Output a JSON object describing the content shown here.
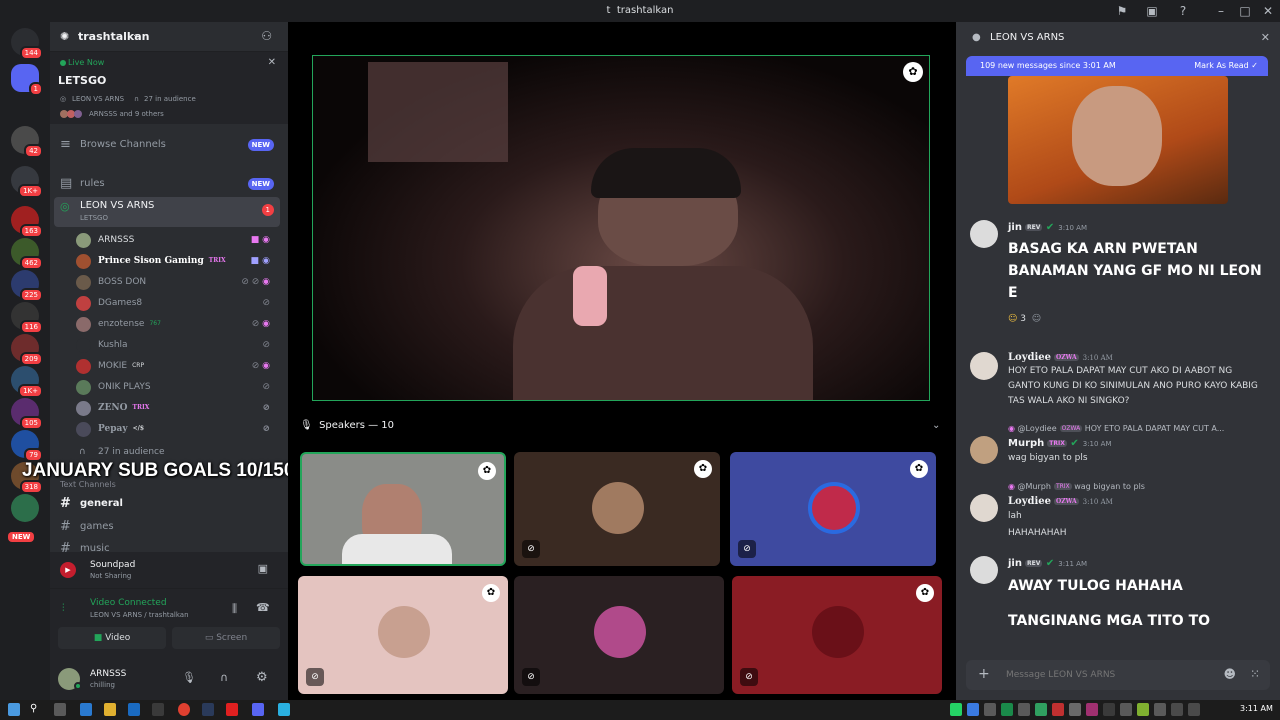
{
  "window": {
    "title": "trashtalkan",
    "title_glyph": "t"
  },
  "servers": {
    "badges": [
      "144",
      "1",
      "42",
      "1K+",
      "163",
      "462",
      "225",
      "116",
      "209",
      "1K+",
      "105",
      "79",
      "318"
    ],
    "new_label": "NEW"
  },
  "channel_sidebar": {
    "server_name": "trashtalkan",
    "live": {
      "status": "Live Now",
      "event": "LETSGO",
      "stage": "LEON VS ARNS",
      "audience": "27 in audience",
      "participants": "ARNSSS and 9 others"
    },
    "browse": "Browse Channels",
    "new_badge": "NEW",
    "rules": "rules",
    "stage_channel": {
      "name": "LEON VS ARNS",
      "topic": "LETSGO",
      "badge": "1"
    },
    "voice_users": [
      {
        "name": "ARNSSS",
        "tag": ""
      },
      {
        "name": "Prince Sison Gaming",
        "tag": "TRIX"
      },
      {
        "name": "BOSS DON",
        "tag": ""
      },
      {
        "name": "DGames8",
        "tag": ""
      },
      {
        "name": "enzotense",
        "tag": "767"
      },
      {
        "name": "Kushla",
        "tag": ""
      },
      {
        "name": "MOKIE",
        "tag": "CRP"
      },
      {
        "name": "ONIK PLAYS",
        "tag": ""
      },
      {
        "name": "ZENO",
        "tag": "TRIX"
      },
      {
        "name": "Pepay",
        "tag": "</$"
      }
    ],
    "audience": "27 in audience",
    "text_channels_header": "Text Channels",
    "text_channels": [
      "general",
      "games",
      "music"
    ],
    "soundpad": {
      "name": "Soundpad",
      "status": "Not Sharing"
    },
    "voice_connected": {
      "status": "Video Connected",
      "location": "LEON VS ARNS / trashtalkan"
    },
    "video_btn": "Video",
    "screen_btn": "Screen",
    "user": {
      "name": "ARNSSS",
      "status": "chilling"
    }
  },
  "overlay_text": "JANUARY SUB GOALS 10/150",
  "stage": {
    "speakers_label": "Speakers — 10"
  },
  "chat": {
    "title": "LEON VS ARNS",
    "new_messages": "109 new messages since 3:01 AM",
    "mark_read": "Mark As Read",
    "messages": [
      {
        "user": "jin",
        "tag": "REV",
        "time": "3:10 AM",
        "text": "BASAG KA ARN PWETAN BANAMAN YANG GF MO NI LEON E",
        "reaction": "3"
      },
      {
        "user": "Loydiee",
        "tag": "OZWA",
        "time": "3:10 AM",
        "text": "HOY ETO PALA DAPAT MAY CUT AKO DI AABOT NG GANTO KUNG DI KO SINIMULAN ANO PURO KAYO KABIG TAS WALA AKO NI SINGKO?"
      },
      {
        "reply_user": "@Loydiee",
        "reply_tag": "OZWA",
        "reply_text": "HOY ETO PALA DAPAT MAY CUT A...",
        "user": "Murph",
        "tag": "TRIX",
        "time": "3:10 AM",
        "text": "wag bigyan to pls"
      },
      {
        "reply_user": "@Murph",
        "reply_tag": "TRIX",
        "reply_text": "wag bigyan to pls",
        "user": "Loydiee",
        "tag": "OZWA",
        "time": "3:10 AM",
        "text": "lah",
        "text2": "HAHAHAHAH"
      },
      {
        "user": "jin",
        "tag": "REV",
        "time": "3:11 AM",
        "text": "AWAY TULOG HAHAHA",
        "text2": "TANGINANG MGA TITO TO"
      }
    ],
    "input_placeholder": "Message LEON VS ARNS"
  },
  "taskbar": {
    "time": "3:11 AM"
  },
  "colors": {
    "green": "#23a55a",
    "blurple": "#5865f2",
    "red": "#f23f43"
  }
}
